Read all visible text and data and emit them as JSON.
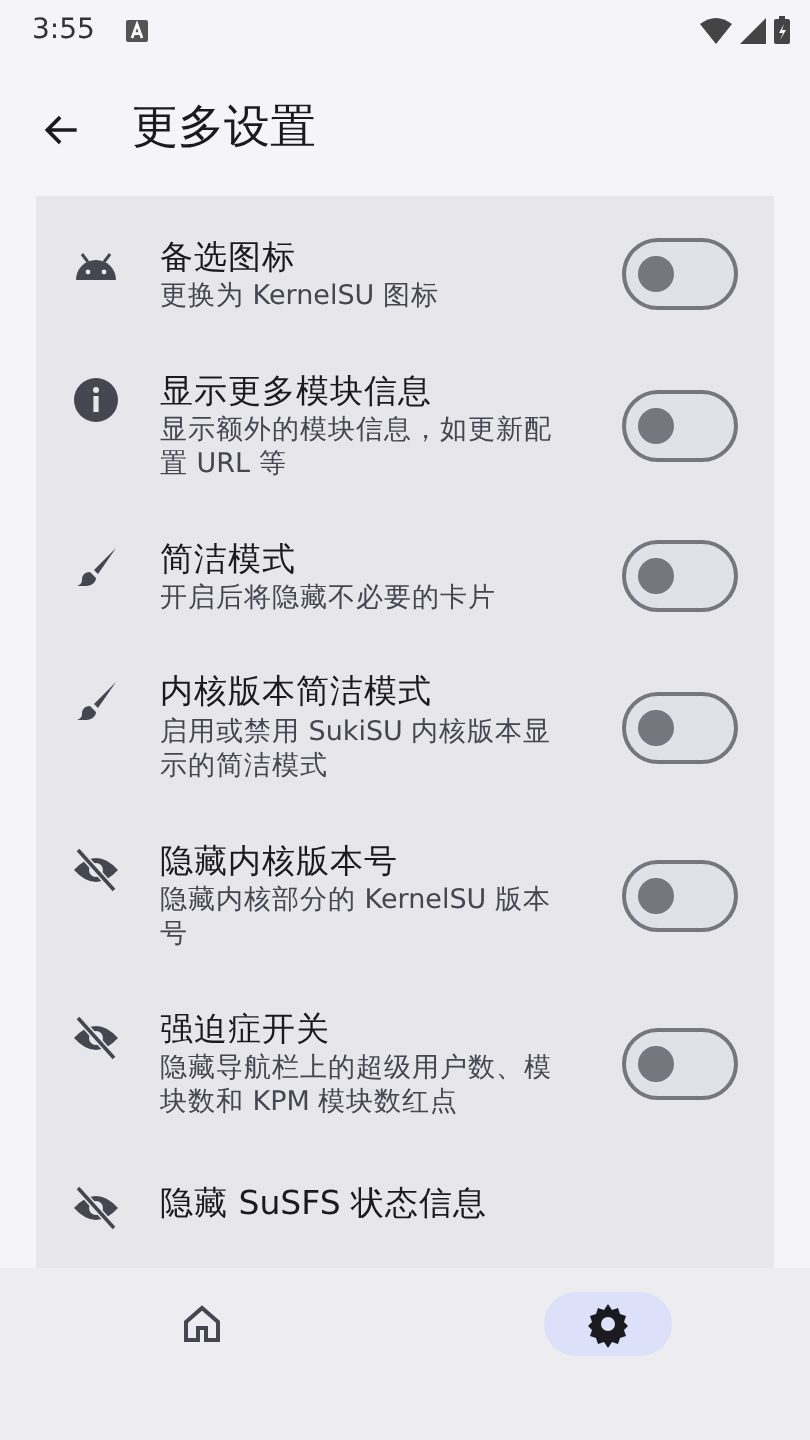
{
  "status_bar": {
    "time": "3:55"
  },
  "header": {
    "title": "更多设置"
  },
  "items": [
    {
      "kind": "android",
      "title": "备选图标",
      "subtitle": "更换为 KernelSU 图标",
      "on": false
    },
    {
      "kind": "info",
      "title": "显示更多模块信息",
      "subtitle": "显示额外的模块信息，如更新配置 URL 等",
      "on": false
    },
    {
      "kind": "brush",
      "title": "简洁模式",
      "subtitle": "开启后将隐藏不必要的卡片",
      "on": false
    },
    {
      "kind": "brush",
      "title": "内核版本简洁模式",
      "subtitle": "启用或禁用 SukiSU 内核版本显示的简洁模式",
      "on": false
    },
    {
      "kind": "eye-off",
      "title": "隐藏内核版本号",
      "subtitle": "隐藏内核部分的 KernelSU 版本号",
      "on": false
    },
    {
      "kind": "eye-off",
      "title": "强迫症开关",
      "subtitle": "隐藏导航栏上的超级用户数、模块数和 KPM 模块数红点",
      "on": false
    },
    {
      "kind": "eye-off",
      "title": "隐藏 SuSFS 状态信息"
    }
  ],
  "nav": [
    {
      "kind": "home",
      "selected": false
    },
    {
      "kind": "settings",
      "selected": true
    }
  ]
}
